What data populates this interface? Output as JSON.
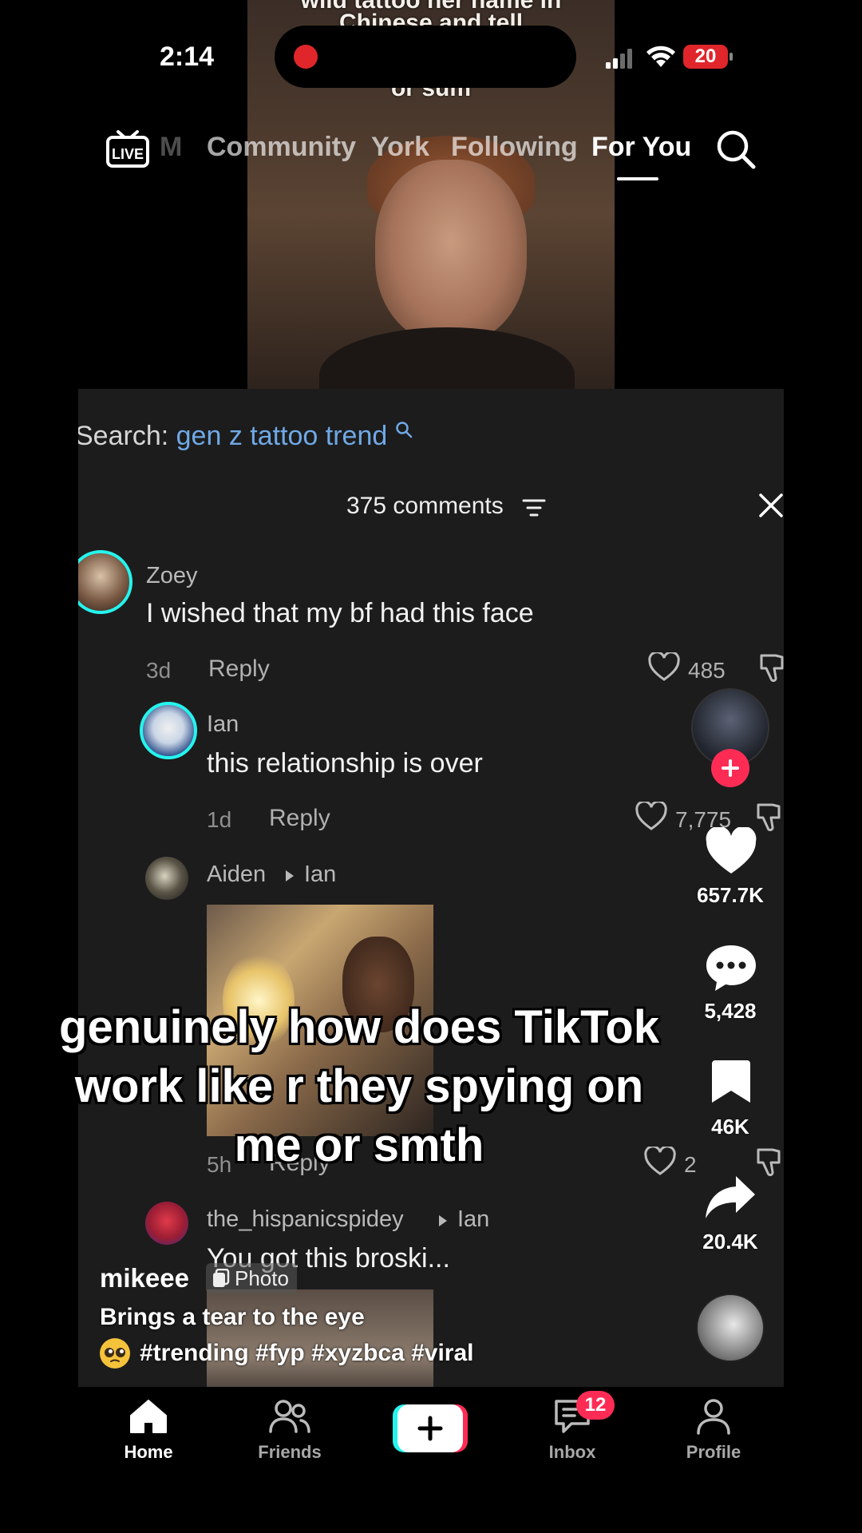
{
  "status_bar": {
    "time": "2:14",
    "battery": "20"
  },
  "video": {
    "caption_line1": "wild tattoo her name in",
    "caption_line2": "Chinese and tell",
    "caption_line3": "or sum"
  },
  "top_nav": {
    "tabs": [
      {
        "label": "M"
      },
      {
        "label": "Community"
      },
      {
        "label": "York"
      },
      {
        "label": "Following"
      },
      {
        "label": "For You"
      }
    ],
    "live_label": "LIVE"
  },
  "comments_panel": {
    "search_prefix": "Search:",
    "search_query": "gen z tattoo trend",
    "count_label": "375 comments",
    "comments": [
      {
        "user": "Zoey",
        "text": "I wished that my bf had this face",
        "age": "3d",
        "reply_label": "Reply",
        "likes": "485"
      },
      {
        "user": "Ian",
        "text": "this relationship is over",
        "age": "1d",
        "reply_label": "Reply",
        "likes": "7,775"
      },
      {
        "user": "Aiden",
        "reply_to": "Ian",
        "age": "5h",
        "reply_label": "Reply",
        "likes": "2"
      },
      {
        "user": "the_hispanicspidey",
        "reply_to": "Ian",
        "text": "You got this broski..."
      }
    ]
  },
  "actions": {
    "likes": "657.7K",
    "comments": "5,428",
    "saves": "46K",
    "shares": "20.4K"
  },
  "overlay": {
    "line1": "genuinely how does TikTok",
    "line2": "work like r they spying on",
    "line3": "me or smth"
  },
  "post": {
    "username": "mikeee",
    "badge": "Photo",
    "title": "Brings a tear to the eye",
    "tags": "#trending #fyp #xyzbca #viral"
  },
  "bottom_nav": {
    "home": "Home",
    "friends": "Friends",
    "inbox": "Inbox",
    "inbox_badge": "12",
    "profile": "Profile"
  },
  "colors": {
    "accent": "#fe2c55",
    "link": "#6fa9e6",
    "cyan": "#25f4ee"
  }
}
